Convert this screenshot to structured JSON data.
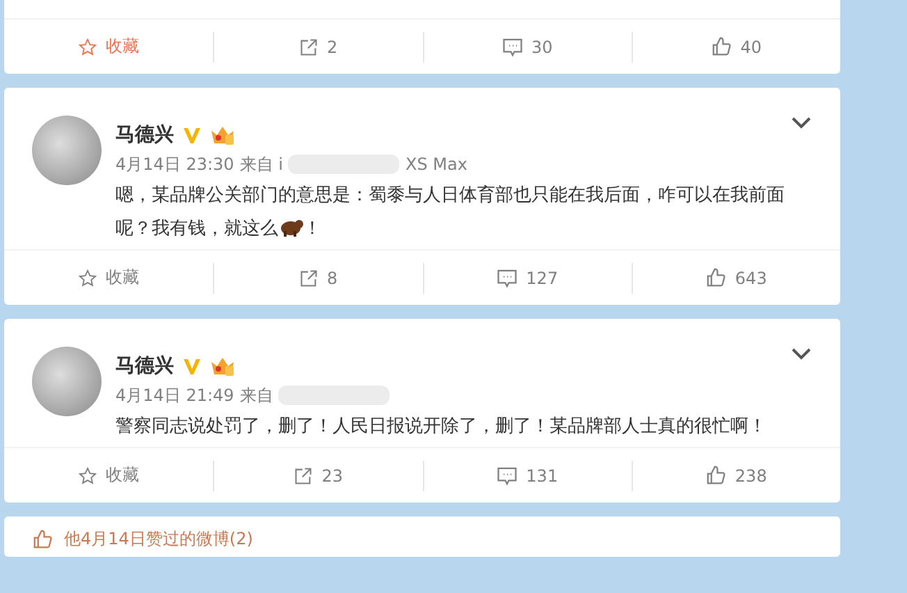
{
  "posts": [
    {
      "kind": "cut_off",
      "actions": {
        "favorite": {
          "label": "收藏",
          "active": true
        },
        "reposts": "2",
        "comments": "30",
        "likes": "40"
      }
    },
    {
      "kind": "full",
      "author": "马德兴",
      "time": "4月14日 23:30",
      "source_prefix": "来自 i",
      "source_suffix": "XS Max",
      "text": "嗯，某品牌公关部门的意思是：蜀黍与人日体育部也只能在我后面，咋可以在我前面呢？我有钱，就这么",
      "emoji_after": "！",
      "actions": {
        "favorite": {
          "label": "收藏",
          "active": false
        },
        "reposts": "8",
        "comments": "127",
        "likes": "643"
      }
    },
    {
      "kind": "full",
      "author": "马德兴",
      "time": "4月14日 21:49",
      "source_prefix": "来自",
      "text": "警察同志说处罚了，删了！人民日报说开除了，删了！某品牌部人士真的很忙啊！",
      "actions": {
        "favorite": {
          "label": "收藏",
          "active": false
        },
        "reposts": "23",
        "comments": "131",
        "likes": "238"
      }
    }
  ],
  "liked_section": {
    "label": "他4月14日赞过的微博(2)"
  }
}
